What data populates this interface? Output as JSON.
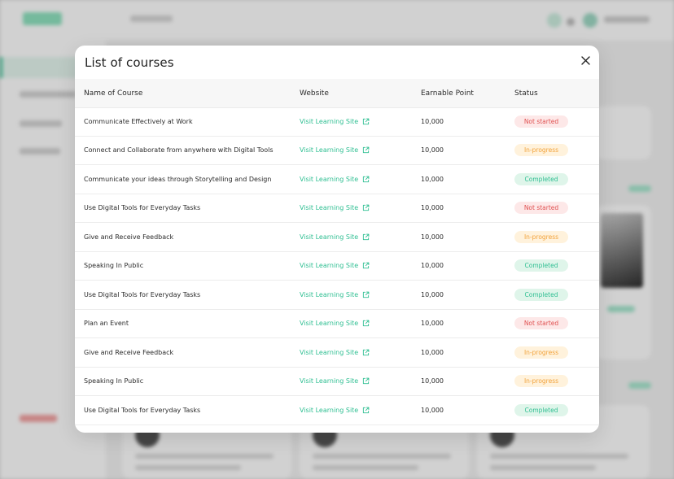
{
  "modal": {
    "title": "List of courses",
    "close_icon": "close-icon",
    "columns": {
      "name": "Name of Course",
      "website": "Website",
      "points": "Earnable Point",
      "status": "Status"
    },
    "link_icon": "external-link-icon",
    "rows": [
      {
        "name": "Communicate Effectively at Work",
        "website": "Visit Learning Site",
        "points": "10,000",
        "status": "Not started"
      },
      {
        "name": "Connect and Collaborate from anywhere with Digital Tools",
        "website": "Visit Learning Site",
        "points": "10,000",
        "status": "In-progress"
      },
      {
        "name": "Communicate your ideas through Storytelling and Design",
        "website": "Visit Learning Site",
        "points": "10,000",
        "status": "Completed"
      },
      {
        "name": "Use Digital Tools for Everyday Tasks",
        "website": "Visit Learning Site",
        "points": "10,000",
        "status": "Not started"
      },
      {
        "name": "Give and Receive Feedback",
        "website": "Visit Learning Site",
        "points": "10,000",
        "status": "In-progress"
      },
      {
        "name": "Speaking In Public",
        "website": "Visit Learning Site",
        "points": "10,000",
        "status": "Completed"
      },
      {
        "name": "Use Digital Tools for Everyday Tasks",
        "website": "Visit Learning Site",
        "points": "10,000",
        "status": "Completed"
      },
      {
        "name": "Plan an Event",
        "website": "Visit Learning Site",
        "points": "10,000",
        "status": "Not started"
      },
      {
        "name": "Give and Receive Feedback",
        "website": "Visit Learning Site",
        "points": "10,000",
        "status": "In-progress"
      },
      {
        "name": "Speaking In Public",
        "website": "Visit Learning Site",
        "points": "10,000",
        "status": "In-progress"
      },
      {
        "name": "Use Digital Tools for Everyday Tasks",
        "website": "Visit Learning Site",
        "points": "10,000",
        "status": "Completed"
      }
    ]
  },
  "colors": {
    "accent": "#2fbf92",
    "not_started_bg": "#fde8e8",
    "not_started_text": "#e05252",
    "in_progress_bg": "#fff2dc",
    "in_progress_text": "#f2a23a",
    "completed_bg": "#dff5ea",
    "completed_text": "#2fbf92"
  }
}
